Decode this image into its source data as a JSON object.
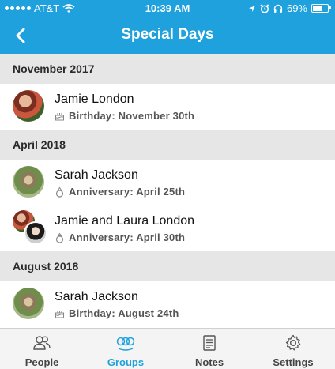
{
  "status_bar": {
    "carrier": "AT&T",
    "time": "10:39 AM",
    "battery_percent": "69%",
    "battery_level": 0.69,
    "icons": [
      "signal-icon",
      "wifi-icon",
      "location-icon",
      "alarm-icon",
      "headphones-icon",
      "battery-icon"
    ]
  },
  "nav": {
    "title": "Special Days",
    "back_icon": "chevron-left-icon"
  },
  "sections": [
    {
      "title": "November 2017",
      "items": [
        {
          "name": "Jamie London",
          "detail": "Birthday: November 30th",
          "icon": "cake-icon"
        }
      ]
    },
    {
      "title": "April 2018",
      "items": [
        {
          "name": "Sarah Jackson",
          "detail": "Anniversary: April 25th",
          "icon": "ring-icon"
        },
        {
          "name": "Jamie and Laura London",
          "detail": "Anniversary: April 30th",
          "icon": "ring-icon"
        }
      ]
    },
    {
      "title": "August 2018",
      "items": [
        {
          "name": "Sarah Jackson",
          "detail": "Birthday: August 24th",
          "icon": "cake-icon"
        }
      ]
    }
  ],
  "tabs": [
    {
      "label": "People",
      "icon": "people-icon",
      "active": false
    },
    {
      "label": "Groups",
      "icon": "groups-icon",
      "active": true
    },
    {
      "label": "Notes",
      "icon": "notes-icon",
      "active": false
    },
    {
      "label": "Settings",
      "icon": "settings-icon",
      "active": false
    }
  ],
  "colors": {
    "accent": "#1ea1dc",
    "section_background": "#e6e6e6",
    "tabbar_background": "#f4f4f4"
  }
}
